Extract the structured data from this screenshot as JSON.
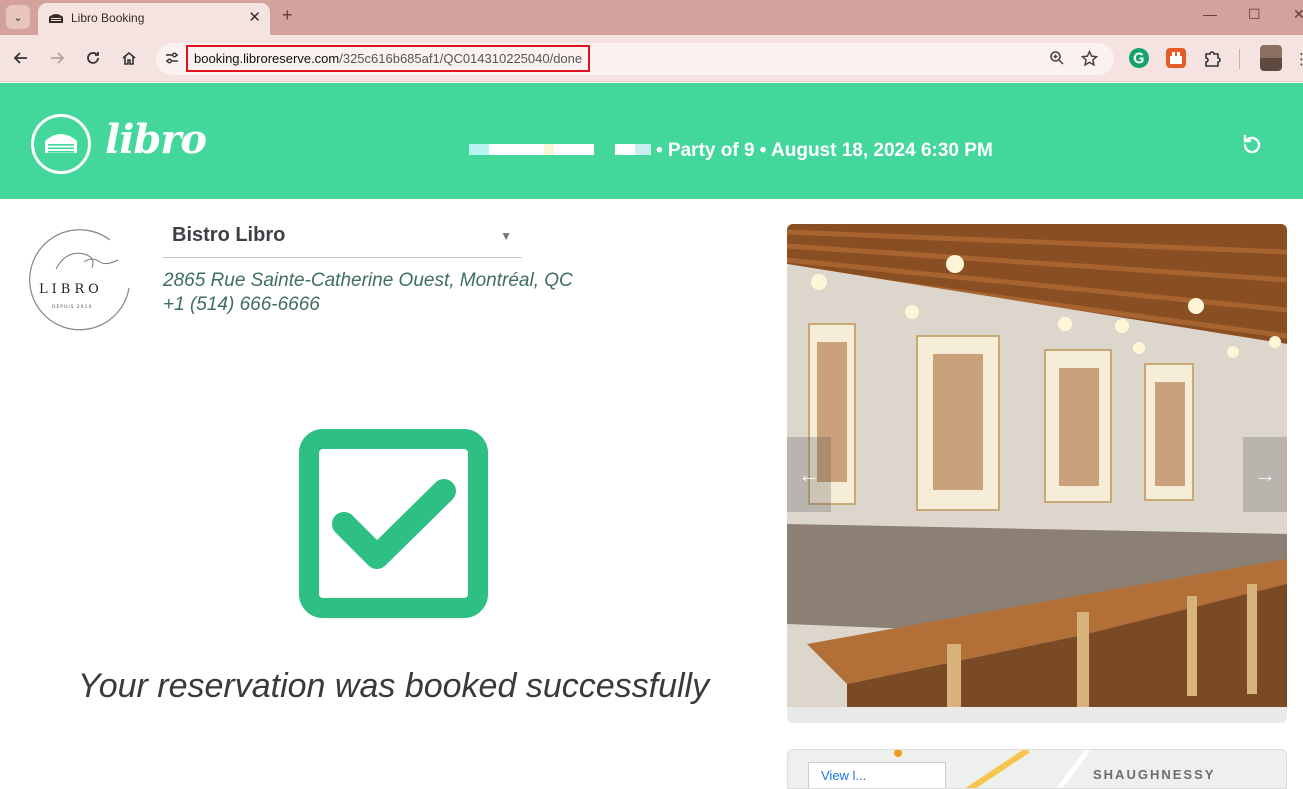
{
  "browser": {
    "tab_title": "Libro Booking",
    "tab_close": "✕",
    "new_tab": "+",
    "url_domain": "booking.libroreserve.com",
    "url_path": "/325c616b685af1/QC014310225040/done",
    "window_controls": {
      "minimize": "—",
      "maximize": "☐",
      "close": "✕"
    }
  },
  "header": {
    "logo_text": "libro",
    "booking_summary": "• Party of 9 • August 18, 2024 6:30 PM"
  },
  "restaurant": {
    "name": "Bistro Libro",
    "address": "2865 Rue Sainte-Catherine Ouest, Montréal, QC",
    "phone": "+1 (514) 666-6666"
  },
  "confirmation": {
    "message": "Your reservation was booked successfully"
  },
  "carousel": {
    "prev": "←",
    "next": "→"
  },
  "map": {
    "area_label": "SHAUGHNESSY",
    "box_text": "View l..."
  },
  "colors": {
    "brand_green": "#43d79c",
    "check_green": "#2ebf84",
    "url_highlight": "#e0141e"
  }
}
